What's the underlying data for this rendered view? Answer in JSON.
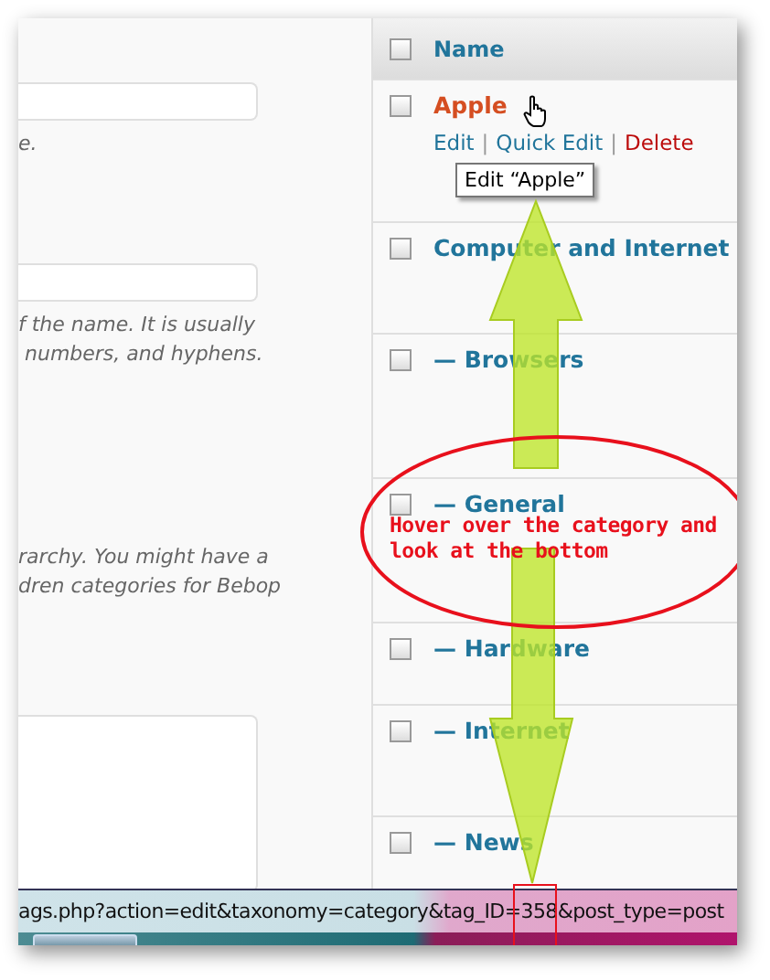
{
  "form": {
    "fields": [
      {
        "kind": "input",
        "hint_lines": [
          "e."
        ]
      },
      {
        "kind": "input",
        "hint_lines": [
          "f the name. It is usually",
          " numbers, and hyphens."
        ]
      },
      {
        "kind": "text",
        "hint_lines": [
          "rarchy. You might have a",
          "dren categories for Bebop"
        ]
      },
      {
        "kind": "textarea"
      }
    ]
  },
  "table": {
    "header": {
      "label": "Name",
      "checked": false
    },
    "rows": [
      {
        "name": "Apple",
        "checked": false,
        "hovered": true,
        "actions": [
          {
            "label": "Edit",
            "kind": "link"
          },
          {
            "label": "Quick Edit",
            "kind": "link"
          },
          {
            "label": "Delete",
            "kind": "delete"
          }
        ],
        "separators": [
          "|",
          "|"
        ],
        "tooltip": "Edit “Apple”"
      },
      {
        "name": "Computer and Internet",
        "checked": false,
        "hovered": false
      },
      {
        "name": "— Browsers",
        "checked": false,
        "hovered": false
      },
      {
        "name": "— General",
        "checked": false,
        "hovered": false
      },
      {
        "name": "— Hardware",
        "checked": false,
        "hovered": false
      },
      {
        "name": "— Internet",
        "checked": false,
        "hovered": false
      },
      {
        "name": "— News",
        "checked": false,
        "hovered": false
      }
    ]
  },
  "annotation": {
    "note": "Hover over the category and look at the bottom"
  },
  "status_bar": {
    "url": "ags.php?action=edit&taxonomy=category&tag_ID=358&post_type=post"
  }
}
